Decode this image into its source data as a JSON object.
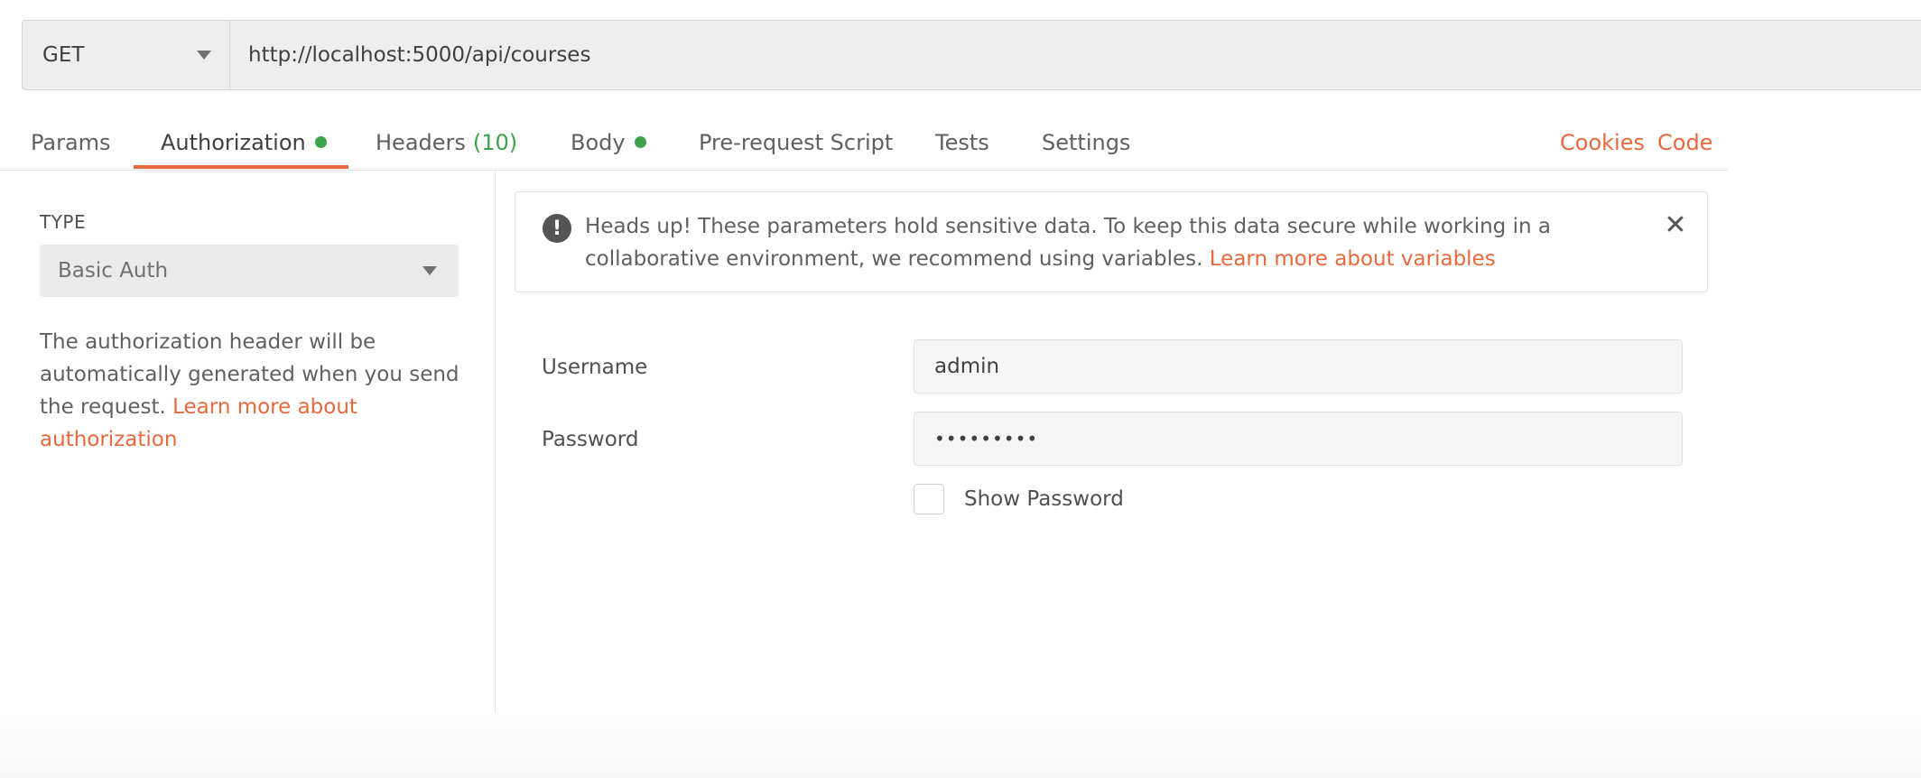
{
  "request": {
    "method": "GET",
    "url": "http://localhost:5000/api/courses"
  },
  "tabs": {
    "params": "Params",
    "authorization": "Authorization",
    "headers": "Headers",
    "headers_count": "(10)",
    "body": "Body",
    "prerequest": "Pre-request Script",
    "tests": "Tests",
    "settings": "Settings",
    "cookies": "Cookies",
    "code": "Code",
    "active": "Authorization",
    "indicator_color": "#3fa34d",
    "accent_color": "#e8693d"
  },
  "auth_panel": {
    "type_label": "TYPE",
    "type_value": "Basic Auth",
    "description": "The authorization header will be automatically generated when you send the request. ",
    "learn_more": "Learn more about authorization"
  },
  "notice": {
    "text": "Heads up! These parameters hold sensitive data. To keep this data secure while working in a collaborative environment, we recommend using variables. ",
    "link": "Learn more about variables",
    "icon": "exclamation-icon",
    "close_icon": "close-icon"
  },
  "credentials": {
    "username_label": "Username",
    "username_value": "admin",
    "password_label": "Password",
    "password_value": "•••••••••",
    "show_password_label": "Show Password"
  }
}
